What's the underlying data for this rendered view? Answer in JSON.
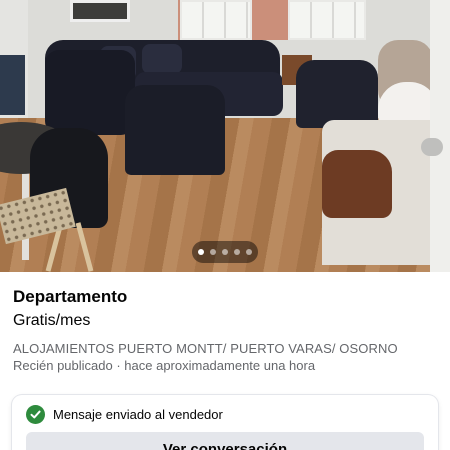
{
  "listing": {
    "title": "Departamento",
    "price": "Gratis/mes",
    "category": "ALOJAMIENTOS PUERTO MONTT/ PUERTO VARAS/ OSORNO",
    "posted": "Recién publicado · hace aproximadamente una hora"
  },
  "carousel": {
    "total": 5,
    "active_index": 0
  },
  "message_card": {
    "status_text": "Mensaje enviado al vendedor",
    "button_label": "Ver conversación"
  },
  "colors": {
    "success": "#2e8b3d",
    "secondary_text": "#65676b",
    "button_bg": "#e4e6eb"
  },
  "icons": {
    "status": "check-circle-icon"
  }
}
